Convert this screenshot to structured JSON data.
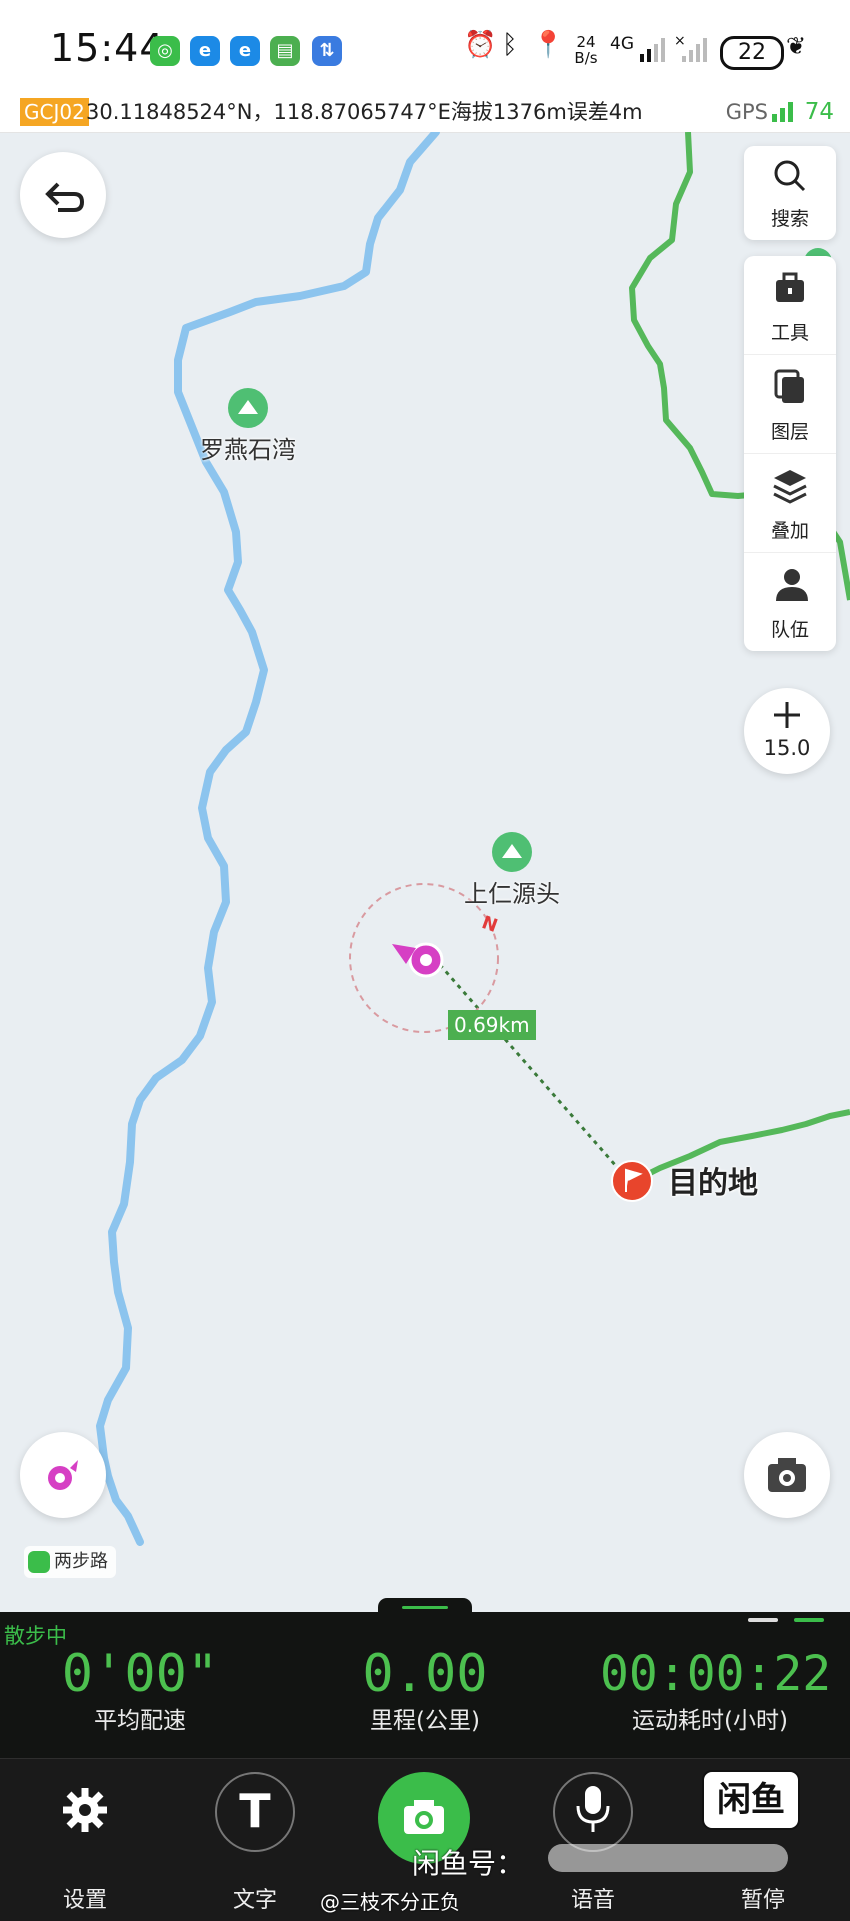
{
  "status_bar": {
    "time": "15:44",
    "net_speed_value": "24",
    "net_speed_unit": "B/s",
    "network": "4G",
    "battery": "22"
  },
  "coord_bar": {
    "system_tag": "GCJ02",
    "coordinates": "30.11848524°N，118.87065747°E海拔1376m误差4m",
    "gps_label": "GPS",
    "gps_satellites": "74"
  },
  "map": {
    "pois": [
      {
        "name": "罗燕石湾"
      },
      {
        "name": "上仁源头"
      }
    ],
    "destination_label": "目的地",
    "distance_label": "0.69km",
    "compass_letter": "N",
    "zoom_level": "15.0",
    "brand_badge": "两步路",
    "colors": {
      "river": "#8cc4ee",
      "trail": "#55b85a",
      "heading": "#d63fc4",
      "destination": "#e8452c"
    }
  },
  "side_panel": {
    "search_label": "搜索",
    "items": [
      {
        "label": "工具",
        "icon": "toolbox-icon"
      },
      {
        "label": "图层",
        "icon": "layers-icon"
      },
      {
        "label": "叠加",
        "icon": "overlay-stack-icon"
      },
      {
        "label": "队伍",
        "icon": "team-icon"
      }
    ]
  },
  "stats": {
    "mode": "散步中",
    "pace_value": "0'00\"",
    "pace_label": "平均配速",
    "distance_value": "0.00",
    "distance_label": "里程(公里)",
    "duration_value": "00:00:22",
    "duration_label": "运动耗时(小时)"
  },
  "toolbar": {
    "settings_label": "设置",
    "text_label": "文字",
    "voice_label": "语音",
    "pause_label": "暂停"
  },
  "overlay": {
    "watermark_text": "闲鱼号：",
    "weibo_text": "@三枝不分正负",
    "xianyu_logo": "闲鱼"
  }
}
